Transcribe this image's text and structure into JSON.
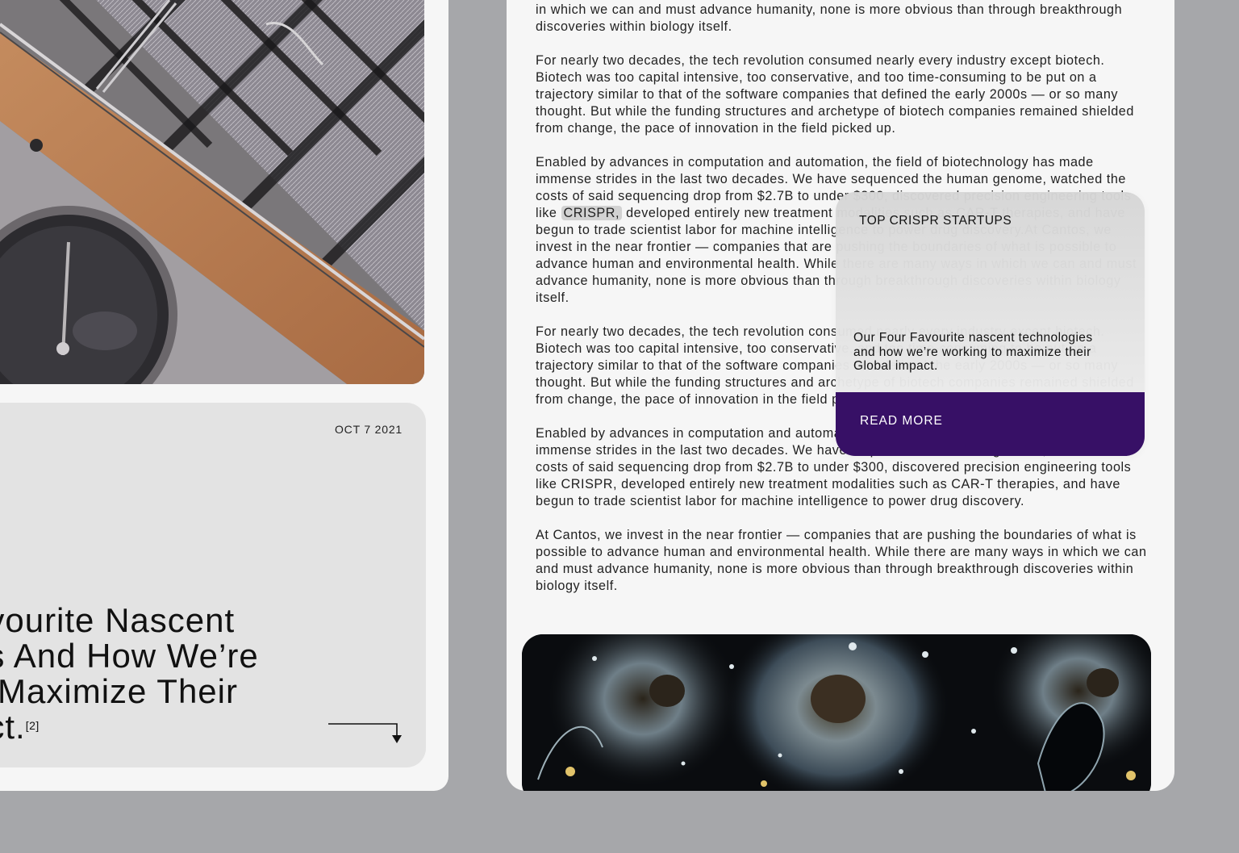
{
  "left_card": {
    "date": "OCT 7 2021",
    "title_lines": [
      "avourite Nascent",
      "es And How We’re",
      "o Maximize Their",
      "act."
    ],
    "footnote": "[2]"
  },
  "article": {
    "paragraphs": [
      "in which we can and must advance humanity, none is more obvious than through breakthrough discoveries within biology itself.",
      "For nearly two decades, the tech revolution consumed nearly every industry except biotech. Biotech was too capital intensive, too conservative, and too time-consuming to be put on a trajectory similar to that of the software companies that defined the early 2000s — or so many thought. But while the funding structures and archetype of biotech companies remained shielded from change, the pace of innovation in the field picked up.",
      {
        "before": "Enabled by advances in computation and automation, the field of biotechnology has made immense strides in the last two decades. We have sequenced the human genome, watched the costs of said sequencing drop from $2.7B to under $300, discovered precision engineering tools like ",
        "highlight": "CRISPR,",
        "after": " developed entirely new treatment modalities such as CAR-T therapies, and have begun to trade scientist labor for machine intelligence to power drug discovery.At Cantos, we invest in the near frontier — companies that are pushing the boundaries of what is possible to advance human and environmental health. While there are many ways in which we can and must advance humanity, none is more obvious than through breakthrough discoveries within biology itself."
      },
      "For nearly two decades, the tech revolution consumed nearly every industry except biotech. Biotech was too capital intensive, too conservative, and too time-consuming to be put on a trajectory similar to that of the software companies that defined the early 2000s — or so many thought. But while the funding structures and archetype of biotech companies remained shielded from change, the pace of innovation in the field picked up.",
      "Enabled by advances in computation and automation, the field of biotechnology has made immense strides in the last two decades. We have sequenced the human genome, watched the costs of said sequencing drop from $2.7B to under $300, discovered precision engineering tools like CRISPR, developed entirely new treatment modalities such as CAR-T therapies, and have begun to trade scientist labor for machine intelligence to power drug discovery.",
      "At Cantos, we invest in the near frontier — companies that are pushing the boundaries of what is possible to advance human and environmental health. While there are many ways in which we can and must advance humanity, none is more obvious than through breakthrough discoveries within biology itself."
    ]
  },
  "popover": {
    "title": "TOP CRISPR STARTUPS",
    "description": "Our Four Favourite nascent technologies and how we’re working to maximize their Global impact.",
    "button_label": "READ MORE",
    "button_color": "#371066"
  },
  "colors": {
    "background": "#a6a7aa",
    "panel": "#f6f6f6",
    "card": "#e3e3e3",
    "highlight": "#d2d2d2"
  },
  "icons": {
    "card_arrow": "arrow-down-right-icon"
  }
}
